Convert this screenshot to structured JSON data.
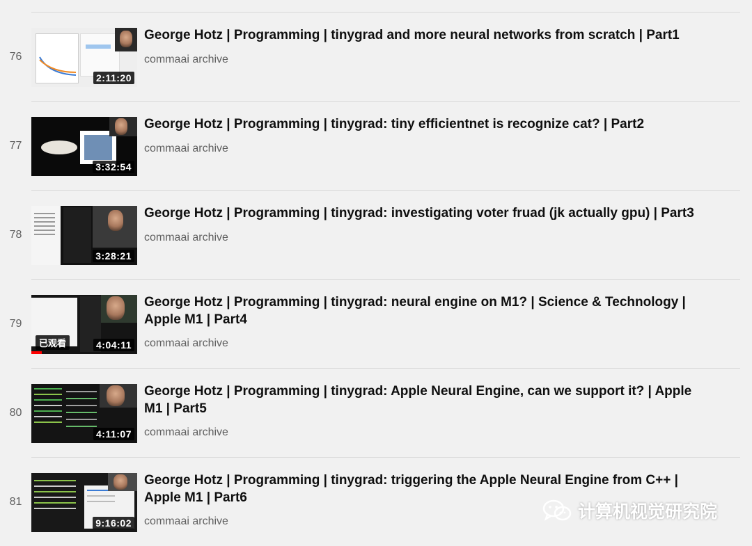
{
  "videos": [
    {
      "index": "76",
      "title": "George Hotz | Programming | tinygrad and more neural networks from scratch | Part1",
      "channel": "commaai archive",
      "duration": "2:11:20",
      "watched_label": "",
      "progress": 0
    },
    {
      "index": "77",
      "title": "George Hotz | Programming | tinygrad: tiny efficientnet is recognize cat? | Part2",
      "channel": "commaai archive",
      "duration": "3:32:54",
      "watched_label": "",
      "progress": 0
    },
    {
      "index": "78",
      "title": "George Hotz | Programming | tinygrad: investigating voter fruad (jk actually gpu) | Part3",
      "channel": "commaai archive",
      "duration": "3:28:21",
      "watched_label": "",
      "progress": 0
    },
    {
      "index": "79",
      "title": "George Hotz | Programming | tinygrad: neural engine on M1? | Science & Technology | Apple M1 | Part4",
      "channel": "commaai archive",
      "duration": "4:04:11",
      "watched_label": "已观看",
      "progress": 0.1
    },
    {
      "index": "80",
      "title": "George Hotz | Programming | tinygrad: Apple Neural Engine, can we support it? | Apple M1 | Part5",
      "channel": "commaai archive",
      "duration": "4:11:07",
      "watched_label": "",
      "progress": 0
    },
    {
      "index": "81",
      "title": "George Hotz | Programming | tinygrad: triggering the Apple Neural Engine from C++ | Apple M1 | Part6",
      "channel": "commaai archive",
      "duration": "9:16:02",
      "watched_label": "",
      "progress": 0
    }
  ],
  "watermark": {
    "text": "计算机视觉研究院",
    "icon": "wechat-icon"
  },
  "colors": {
    "background": "#f1f1f1",
    "progress": "#ff0000",
    "title": "#0f0f0f",
    "meta": "#606060"
  }
}
